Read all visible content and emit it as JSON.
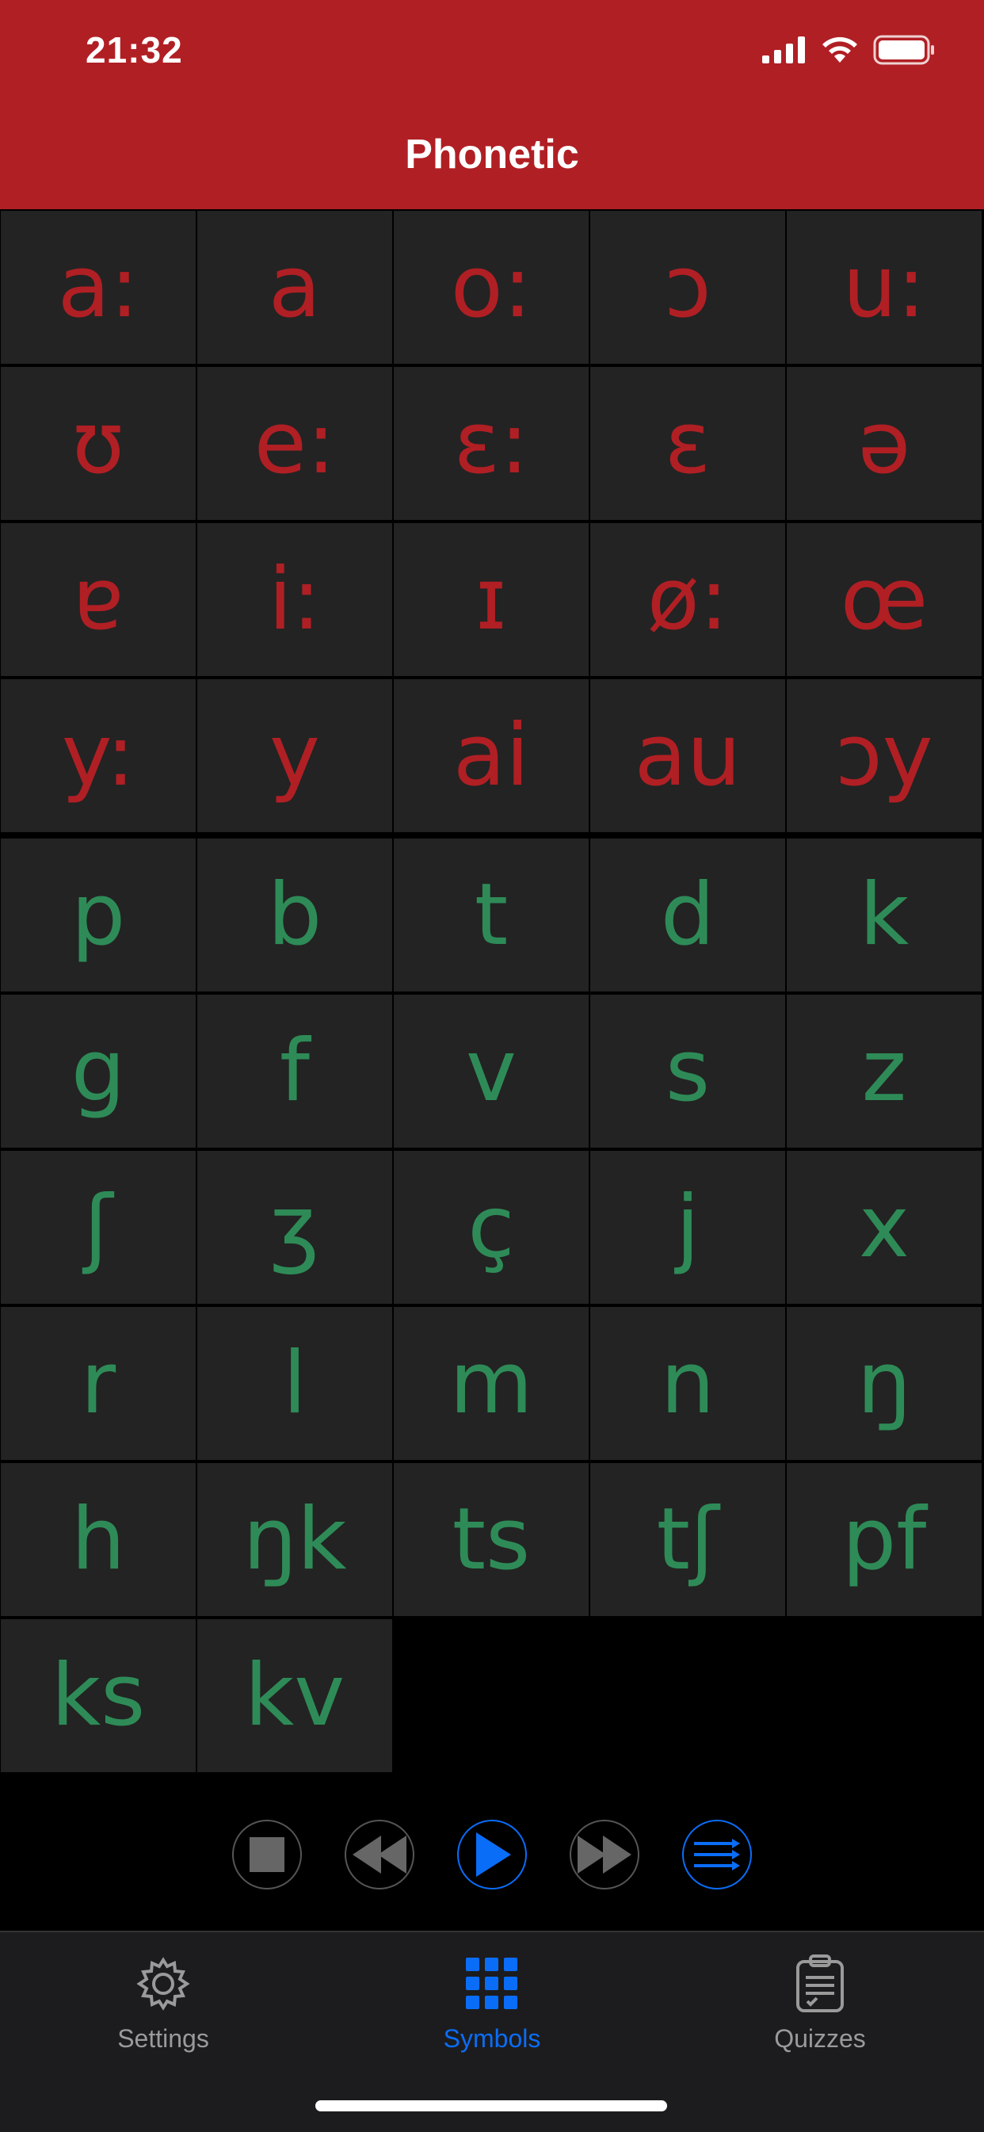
{
  "status_bar": {
    "time": "21:32"
  },
  "header": {
    "title": "Phonetic"
  },
  "vowels": [
    [
      "a:",
      "a",
      "o:",
      "ɔ",
      "u:"
    ],
    [
      "ʊ",
      "e:",
      "ɛ:",
      "ɛ",
      "ə"
    ],
    [
      "ɐ",
      "i:",
      "ɪ",
      "ø:",
      "œ"
    ],
    [
      "y:",
      "y",
      "ai",
      "au",
      "ɔy"
    ]
  ],
  "consonants": [
    [
      "p",
      "b",
      "t",
      "d",
      "k"
    ],
    [
      "g",
      "f",
      "v",
      "s",
      "z"
    ],
    [
      "ʃ",
      "ʒ",
      "ç",
      "j",
      "x"
    ],
    [
      "r",
      "l",
      "m",
      "n",
      "ŋ"
    ],
    [
      "h",
      "ŋk",
      "ts",
      "tʃ",
      "pf"
    ],
    [
      "ks",
      "kv"
    ]
  ],
  "colors": {
    "header": "#b01f24",
    "vowel": "#b01f24",
    "consonant": "#2e8b57",
    "accent": "#0a6df7"
  },
  "controls": [
    {
      "name": "stop-button",
      "icon": "stop-icon"
    },
    {
      "name": "rewind-button",
      "icon": "rewind-icon"
    },
    {
      "name": "play-button",
      "icon": "play-icon"
    },
    {
      "name": "fast-forward-button",
      "icon": "fast-forward-icon"
    },
    {
      "name": "playlist-button",
      "icon": "list-icon"
    }
  ],
  "tabs": [
    {
      "label": "Settings",
      "icon": "gear-icon"
    },
    {
      "label": "Symbols",
      "icon": "grid-icon"
    },
    {
      "label": "Quizzes",
      "icon": "clipboard-icon"
    }
  ]
}
